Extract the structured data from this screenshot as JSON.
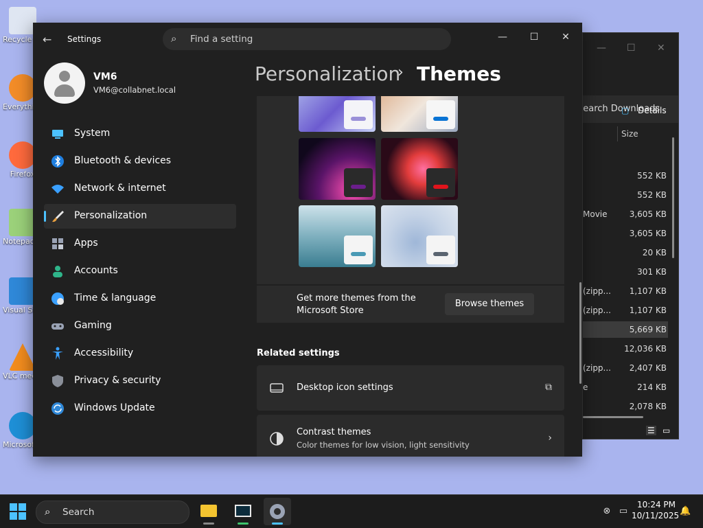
{
  "desktop": {
    "icons": [
      {
        "label": "Recycle Bin",
        "color": "#dfe6f2"
      },
      {
        "label": "Everything",
        "color": "#f28c28"
      },
      {
        "label": "Firefox",
        "color": "#ff6a3d"
      },
      {
        "label": "Notepad++",
        "color": "#9bd17a"
      },
      {
        "label": "Visual Studio Code",
        "color": "#2f88d8"
      },
      {
        "label": "VLC media player",
        "color": "#f28c1e"
      },
      {
        "label": "Microsoft Edge",
        "color": "#1e8fd6"
      }
    ]
  },
  "explorer": {
    "search_placeholder": "Search Downloads",
    "details_label": "Details",
    "size_header": "Size",
    "rows": [
      {
        "name": "",
        "size": "552 KB"
      },
      {
        "name": "",
        "size": "552 KB"
      },
      {
        "name": "Movie",
        "size": "3,605 KB"
      },
      {
        "name": "",
        "size": "3,605 KB"
      },
      {
        "name": "",
        "size": "20 KB"
      },
      {
        "name": "",
        "size": "301 KB"
      },
      {
        "name": "(zipp...",
        "size": "1,107 KB"
      },
      {
        "name": "(zipp...",
        "size": "1,107 KB"
      },
      {
        "name": "",
        "size": "5,669 KB"
      },
      {
        "name": "",
        "size": "12,036 KB"
      },
      {
        "name": "(zipp...",
        "size": "2,407 KB"
      },
      {
        "name": "e",
        "size": "214 KB"
      },
      {
        "name": "",
        "size": "2,078 KB"
      }
    ]
  },
  "settings": {
    "app_title": "Settings",
    "search_placeholder": "Find a setting",
    "user": {
      "name": "VM6",
      "email": "VM6@collabnet.local"
    },
    "nav": [
      {
        "label": "System",
        "icon": "monitor-icon",
        "color": "#4cc2ff"
      },
      {
        "label": "Bluetooth & devices",
        "icon": "bluetooth-icon",
        "color": "#1f7fe0"
      },
      {
        "label": "Network & internet",
        "icon": "wifi-icon",
        "color": "#3aa0ff"
      },
      {
        "label": "Personalization",
        "icon": "brush-icon",
        "color": "#e8a040"
      },
      {
        "label": "Apps",
        "icon": "apps-icon",
        "color": "#9aa3b5"
      },
      {
        "label": "Accounts",
        "icon": "person-icon",
        "color": "#2fb58a"
      },
      {
        "label": "Time & language",
        "icon": "globe-clock-icon",
        "color": "#3aa0ff"
      },
      {
        "label": "Gaming",
        "icon": "gamepad-icon",
        "color": "#9aa3b5"
      },
      {
        "label": "Accessibility",
        "icon": "accessibility-icon",
        "color": "#3aa0ff"
      },
      {
        "label": "Privacy & security",
        "icon": "shield-icon",
        "color": "#8a8f99"
      },
      {
        "label": "Windows Update",
        "icon": "update-icon",
        "color": "#2f88d8"
      }
    ],
    "active_nav": "Personalization",
    "breadcrumb": {
      "parent": "Personalization",
      "separator": "›",
      "current": "Themes"
    },
    "themes": {
      "thumbnails": [
        {
          "bg": "linear-gradient(135deg,#b8c6f0,#6c5bd0 55%,#c6d0f6)",
          "accent": "#9a90d8",
          "swatch_bg": "#f4f4f8"
        },
        {
          "bg": "linear-gradient(135deg,#d9a37a,#f0e6dc 55%,#9aa8bf)",
          "accent": "#0a74d4",
          "swatch_bg": "#f6f6f6"
        },
        {
          "bg": "radial-gradient(circle at 70% 85%,#ff4fb2,#5a1468 45%,#10081c 80%)",
          "accent": "#6b1e8c",
          "swatch_bg": "#2a2a2a"
        },
        {
          "bg": "radial-gradient(circle at 55% 50%,#ff6fa0,#e23c3c 30%,#2a0a18 70%)",
          "accent": "#e0141c",
          "swatch_bg": "#2a2a2a"
        },
        {
          "bg": "linear-gradient(180deg,#cde2ea,#7fb0bf 50%,#3a7d90)",
          "accent": "#4a9ab5",
          "swatch_bg": "#f4f4f4"
        },
        {
          "bg": "radial-gradient(circle at 45% 60%,#9fb7d8,#c5d3e6 50%,#dfe6ef)",
          "accent": "#5a6470",
          "swatch_bg": "#f4f4f4"
        }
      ],
      "more_text": "Get more themes from the Microsoft Store",
      "browse_label": "Browse themes"
    },
    "related": {
      "heading": "Related settings",
      "items": [
        {
          "title": "Desktop icon settings",
          "subtitle": "",
          "icon": "desktop-icon",
          "action": "external-link-icon"
        },
        {
          "title": "Contrast themes",
          "subtitle": "Color themes for low vision, light sensitivity",
          "icon": "contrast-icon",
          "action": "chevron-right-icon"
        }
      ]
    }
  },
  "taskbar": {
    "search_placeholder": "Search",
    "apps": [
      {
        "name": "file-explorer",
        "active": false
      },
      {
        "name": "media-app",
        "active": false
      },
      {
        "name": "settings",
        "active": true
      }
    ],
    "time": "10:24 PM",
    "date": "10/11/2025",
    "accent": "#4cc2ff"
  }
}
